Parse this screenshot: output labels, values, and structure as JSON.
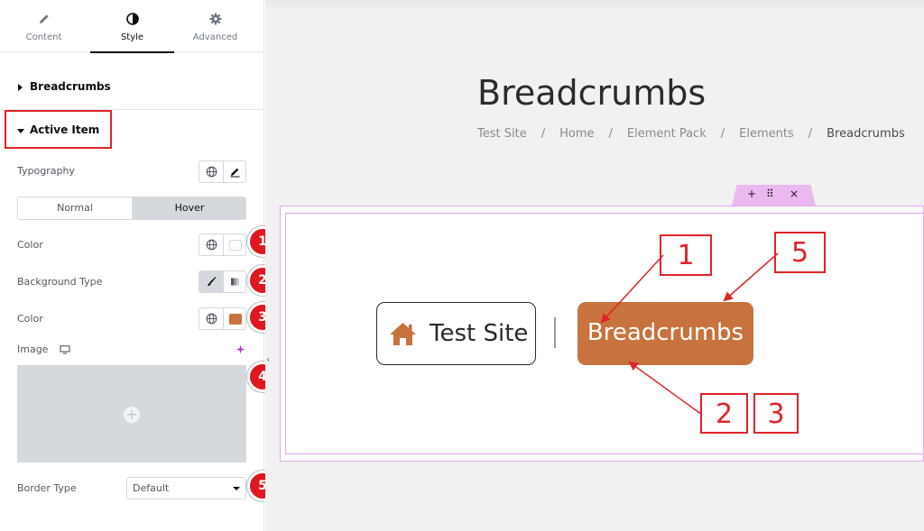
{
  "panel": {
    "tabs": [
      {
        "label": "Content",
        "icon": "pencil-icon"
      },
      {
        "label": "Style",
        "icon": "half-circle-icon",
        "active": true
      },
      {
        "label": "Advanced",
        "icon": "gear-icon"
      }
    ],
    "sections": {
      "breadcrumbs": "Breadcrumbs",
      "active_item": "Active Item"
    },
    "controls": {
      "typography": "Typography",
      "state_normal": "Normal",
      "state_hover": "Hover",
      "color_1": "Color",
      "background_type": "Background Type",
      "color_2": "Color",
      "image": "Image",
      "border_type": "Border Type",
      "border_type_value": "Default"
    },
    "badges": [
      "1",
      "2",
      "3",
      "4",
      "5"
    ]
  },
  "preview": {
    "page_title": "Breadcrumbs",
    "crumbs": [
      "Test Site",
      "Home",
      "Element Pack",
      "Elements",
      "Breadcrumbs"
    ],
    "crumb_separator": "/",
    "widget": {
      "home_label": "Test Site",
      "active_label": "Breadcrumbs"
    },
    "handle": {
      "add": "+",
      "drag": "⠿",
      "close": "×"
    },
    "callouts": [
      "1",
      "5",
      "2",
      "3"
    ]
  },
  "colors": {
    "accent_active": "#c8733e",
    "annotation_red": "#e0242a",
    "section_border": "#e4a7ea"
  }
}
